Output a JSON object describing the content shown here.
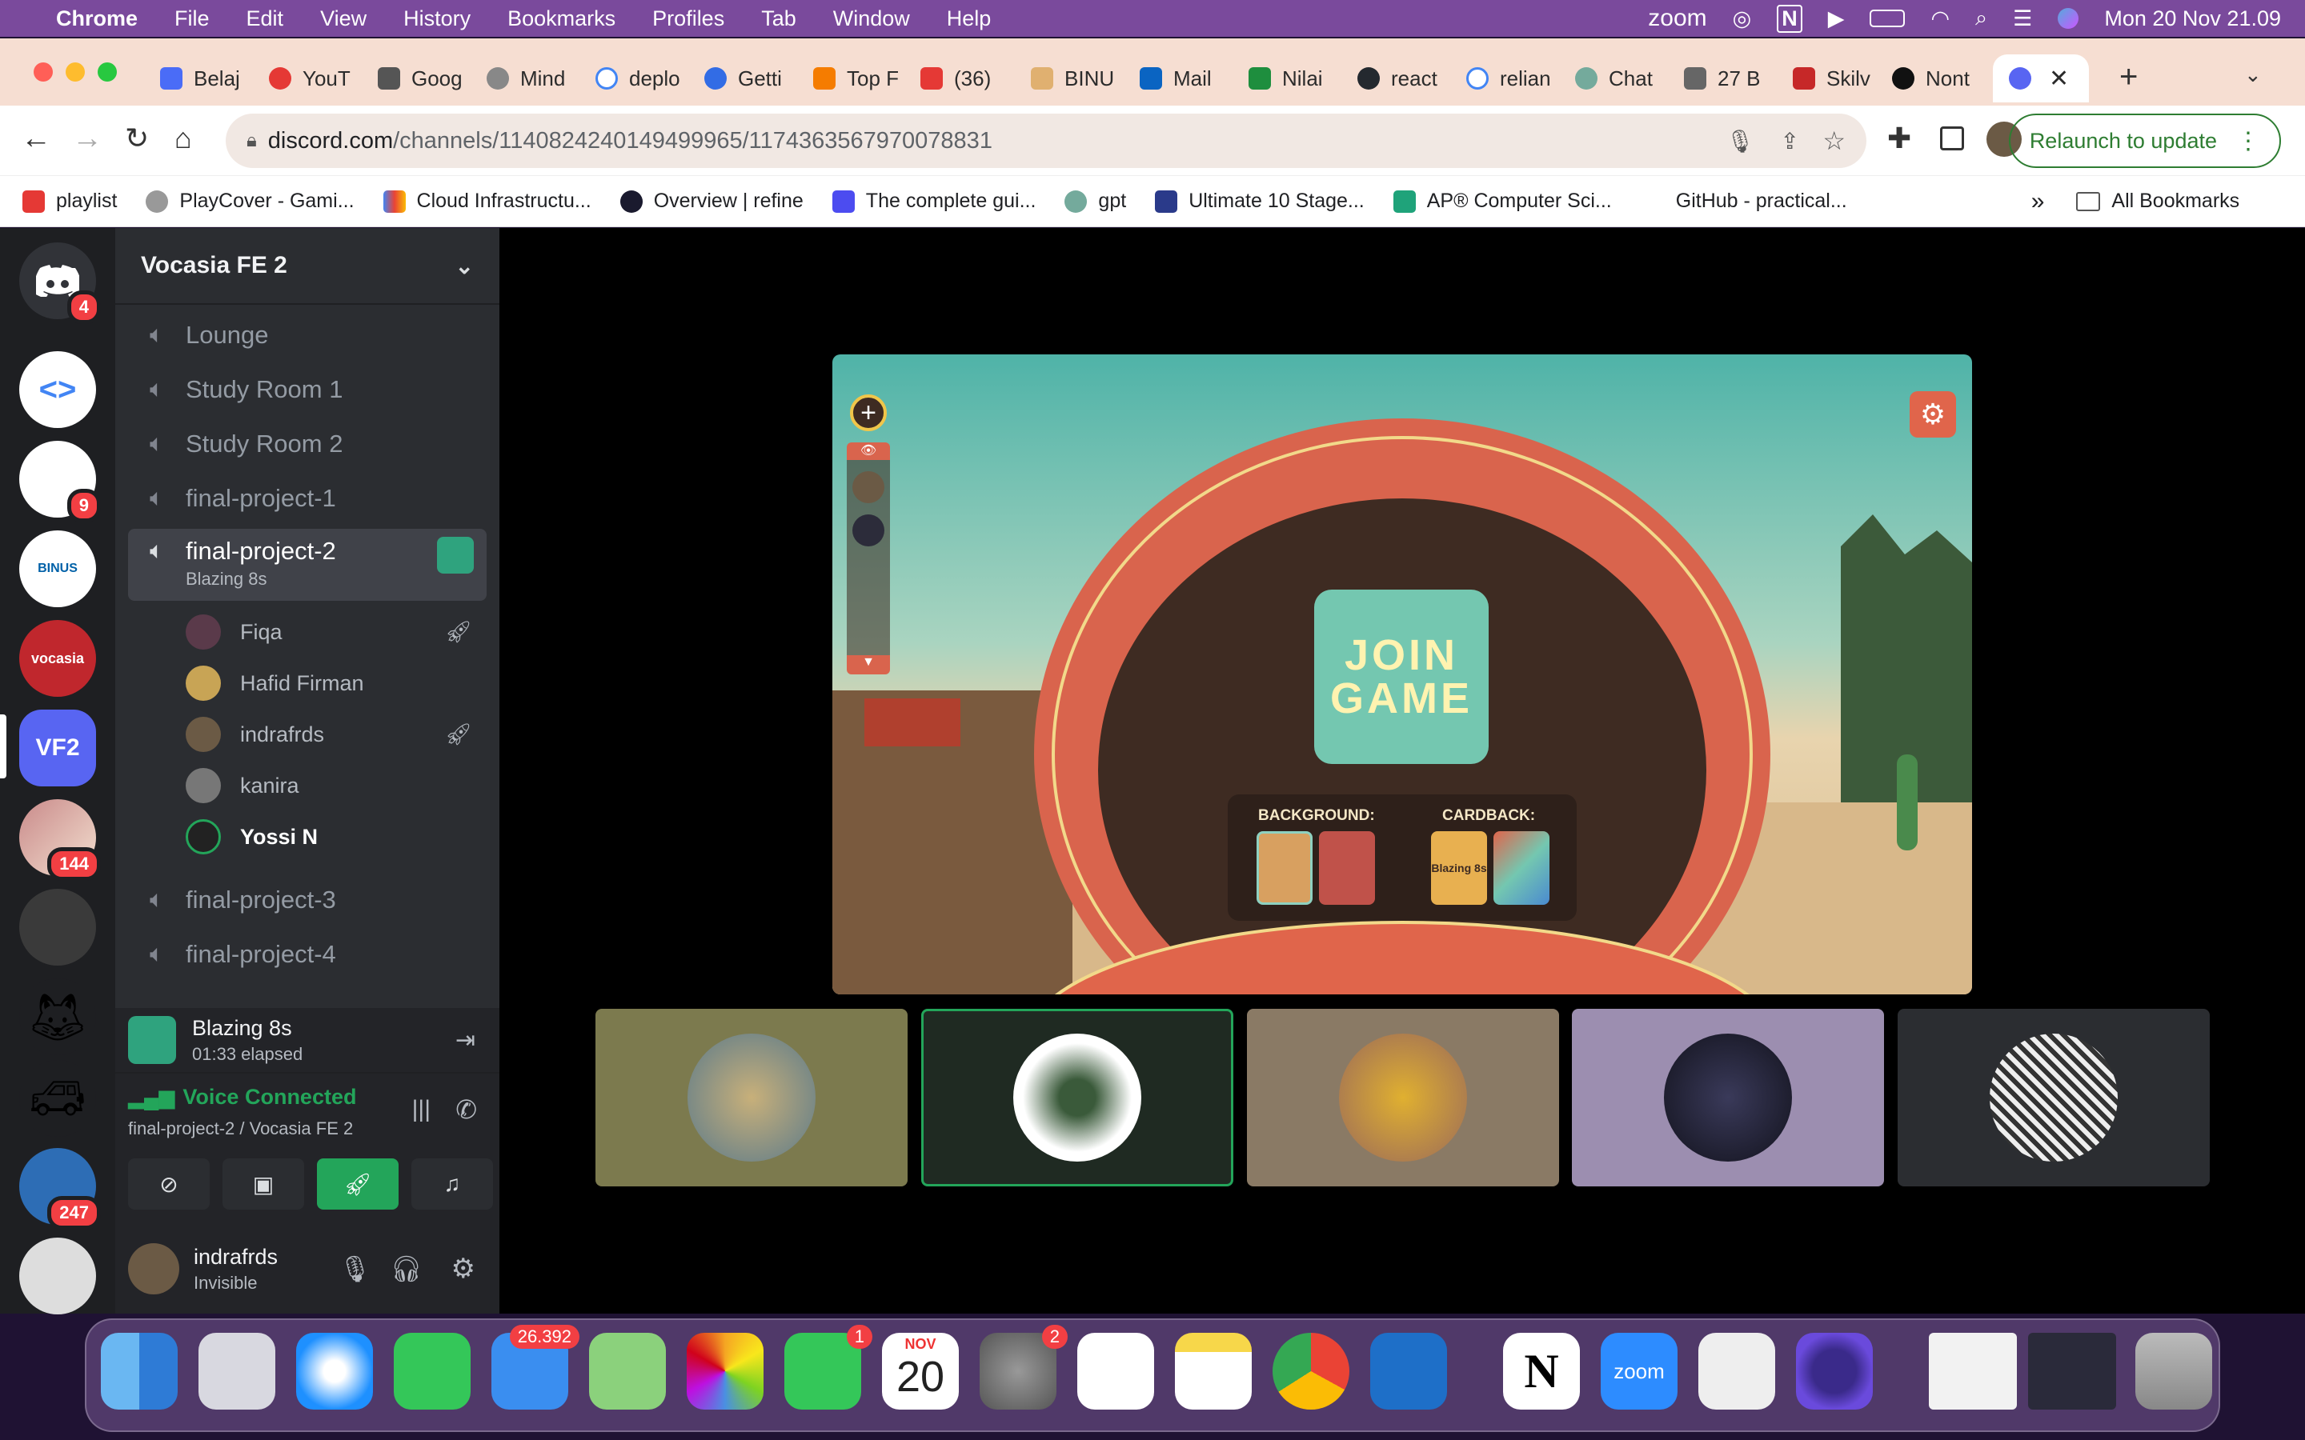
{
  "menubar": {
    "app": "Chrome",
    "items": [
      "File",
      "Edit",
      "View",
      "History",
      "Bookmarks",
      "Profiles",
      "Tab",
      "Window",
      "Help"
    ],
    "zoom": "zoom",
    "datetime": "Mon 20 Nov  21.09"
  },
  "tabs": [
    "Belaj",
    "YouT",
    "Goog",
    "Mind",
    "deplo",
    "Getti",
    "Top F",
    "(36)",
    "BINU",
    "Mail",
    "Nilai",
    "react",
    "relian",
    "Chat",
    "27 B",
    "Skilv",
    "Nont"
  ],
  "url": {
    "host": "discord.com",
    "path": "/channels/1140824240149499965/1174363567970078831"
  },
  "relaunch": "Relaunch to update",
  "bookmarks": [
    "playlist",
    "PlayCover - Gami...",
    "Cloud Infrastructu...",
    "Overview | refine",
    "The complete gui...",
    "gpt",
    "Ultimate 10 Stage...",
    "AP® Computer Sci...",
    "GitHub - practical..."
  ],
  "all_bookmarks": "All Bookmarks",
  "more_bookmarks": "»",
  "servers": {
    "badges": [
      "4",
      "9",
      "144",
      "247"
    ],
    "vf2": "VF2"
  },
  "guild": {
    "name": "Vocasia FE 2"
  },
  "channels": [
    "Lounge",
    "Study Room 1",
    "Study Room 2",
    "final-project-1",
    "final-project-2",
    "final-project-3",
    "final-project-4"
  ],
  "active_activity": "Blazing 8s",
  "voice_users": [
    "Fiqa",
    "Hafid Firman",
    "indrafrds",
    "kanira",
    "Yossi N"
  ],
  "activity": {
    "name": "Blazing 8s",
    "elapsed": "01:33 elapsed"
  },
  "voice": {
    "status": "Voice Connected",
    "location": "final-project-2 / Vocasia FE 2"
  },
  "user": {
    "name": "indrafrds",
    "status": "Invisible"
  },
  "game": {
    "join_line1": "JOIN",
    "join_line2": "GAME",
    "background_label": "BACKGROUND:",
    "cardback_label": "CARDBACK:",
    "cardback_text": "Blazing 8s"
  },
  "dock": {
    "mail_badge": "26.392",
    "facetime_badge": "1",
    "settings_badge": "2",
    "cal_month": "NOV",
    "cal_day": "20",
    "zoom": "zoom"
  }
}
